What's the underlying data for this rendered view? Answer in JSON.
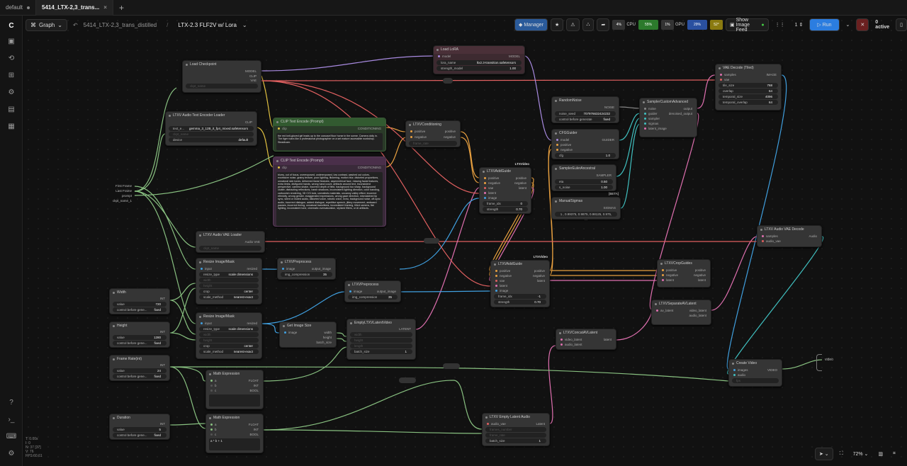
{
  "tabs": [
    {
      "label": "default"
    },
    {
      "label": "5414_LTX-2,3_trans..."
    }
  ],
  "topbar": {
    "graph": "Graph",
    "workflow": "5414_LTX-2,3_trans_distilled",
    "sep": "/",
    "subgraph": "LTX-2.3 FLF2V w/ Lora"
  },
  "toolbar": {
    "manager": "Manager",
    "cpu": "4%",
    "cpu_label": "CPU",
    "ram": "55%",
    "ram_label": "RAM",
    "gpu": "1%",
    "gpu_label": "GPU",
    "vram": "29%",
    "vram_label": "VRAM",
    "temp": "52°",
    "temp_label": "Temp",
    "show_feed": "Show Image Feed",
    "queue": "1",
    "run": "Run",
    "active": "0 active"
  },
  "colors": {
    "blue": "#3a8de0",
    "green": "#5fbf6a",
    "purple": "#a56bd1",
    "pink": "#e070b0",
    "orange": "#e0a040",
    "red": "#e06060",
    "cyan": "#40c0c0"
  },
  "nodes": {
    "lora": {
      "title": "Load LoRA",
      "model": "model",
      "model_out": "MODEL",
      "lora_name": "lora_name",
      "lora_val": "ltx2.3-transition.safetensors",
      "strength": "strength_model",
      "strength_val": "1.00"
    },
    "ckpt": {
      "title": "Load Checkpoint",
      "model": "MODEL",
      "clip": "CLIP",
      "vae": "VAE",
      "ckpt": "ckpt_name"
    },
    "audio_enc": {
      "title": "LTXV Audio Text Encoder Loader",
      "clip": "CLIP",
      "name": "text_e...",
      "name_val": "gemma_3_12B_it_fp4_mixed.safetensors",
      "ckpt": "ckpt_name",
      "device": "device",
      "device_val": "default"
    },
    "pos": {
      "title": "CLIP Text Encode (Prompt)",
      "clip": "clip",
      "out": "CONDITIONING",
      "text": "the red knit-gloved girl leads up to the carousel floor horse in the scene. Camera dolly in. The tiger roars like a professional photographer on a set mature accessible workshop. Steadicam."
    },
    "neg": {
      "title": "CLIP Text Encode (Prompt)",
      "clip": "clip",
      "out": "CONDITIONING",
      "text": "blurry, out of focus, overexposed, underexposed, low contrast, washed out colors, excessive noise, grainy texture, poor lighting, flickering, motion blur, distorted proportions, unnatural skin tones, deformed facial features, asymmetrical face, missing facial features, extra limbs, disfigured hands, wrong hand count, artifacts around text, inconsistent perspective, camera shake, incorrect depth of field, background too sharp, background clutter, distracting reflections, harsh shadows, inconsistent lighting direction, color banding, cartoonish rendering, 3D CGI look, unrealistic materials, uncanny valley effect, incorrect ethnicity, wrong gender, exaggerated expressions, wrong gaze direction, mismatched lip sync, silent or muted audio, distorted voice, robotic voice, echo, background noise, off-sync audio, incorrect dialogue, added dialogue, repetitive speech, jittery movement, awkward pauses, incorrect timing, unnatural transitions, inconsistent framing, tilted camera, flat lighting, inconsistent tone, cinematic oversaturation, stylized filters, or AI artifacts."
    },
    "cond": {
      "title": "LTXVConditioning",
      "pos": "positive",
      "neg": "negative",
      "pos_out": "positive",
      "neg_out": "negative",
      "fr": "frame_rate"
    },
    "add1": {
      "title": "LTXVAddGuide",
      "badge": "LTXVideo",
      "pos": "positive",
      "neg": "negative",
      "vae": "vae",
      "latent": "latent",
      "image": "image",
      "pos_o": "positive",
      "neg_o": "negative",
      "lat_o": "latent",
      "fi": "frame_idx",
      "fi_v": "0",
      "st": "strength",
      "st_v": "0.70"
    },
    "add2": {
      "title": "LTXVAddGuide",
      "badge": "LTXVideo",
      "pos": "positive",
      "neg": "negative",
      "vae": "vae",
      "latent": "latent",
      "image": "image",
      "pos_o": "positive",
      "neg_o": "negative",
      "lat_o": "latent",
      "fi": "frame_idx",
      "fi_v": "-1",
      "st": "strength",
      "st_v": "0.70"
    },
    "noise": {
      "title": "RandomNoise",
      "out": "NOISE",
      "seed": "noise_seed",
      "seed_v": "707976632424232",
      "ctrl": "control before generate",
      "ctrl_v": "fixed"
    },
    "cfg": {
      "title": "CFGGuider",
      "model": "model",
      "pos": "positive",
      "neg": "negative",
      "out": "GUIDER",
      "cfg": "cfg",
      "cfg_v": "1.0"
    },
    "sampsel": {
      "title": "SamplerEulerAncestral",
      "out": "SAMPLER",
      "eta": "eta",
      "eta_v": "0.50",
      "s": "s_noise",
      "s_v": "1.00"
    },
    "sigmas": {
      "title": "ManualSigmas",
      "badge": "[BETA]",
      "out": "SIGMAS",
      "v": "1., 0.99375, 0.9875, 0.98125, 0.975, ..."
    },
    "sca": {
      "title": "SamplerCustomAdvanced",
      "noise": "noise",
      "guider": "guider",
      "sampler": "sampler",
      "sigmas": "sigmas",
      "lat": "latent_image",
      "out": "output",
      "den": "denoised_output"
    },
    "vaedec": {
      "title": "VAE Decode (Tiled)",
      "samples": "samples",
      "vae": "vae",
      "out": "IMAGE",
      "t1": "tile_size",
      "t1v": "768",
      "t2": "overlap",
      "t2v": "64",
      "t3": "temporal_size",
      "t3v": "4096",
      "t4": "temporal_overlap",
      "t4v": "64"
    },
    "avae": {
      "title": "LTXV Audio VAE Loader",
      "out": "Audio VAE",
      "ck": "ckpt_name"
    },
    "adec": {
      "title": "LTXV Audio VAE Decode",
      "samples": "samples",
      "vae": "audio_vae",
      "out": "Audio"
    },
    "rs1": {
      "title": "Resize Image/Mask",
      "input": "input",
      "out": "resized",
      "rt": "resize_type",
      "rtv": "scale dimensions",
      "w": "width",
      "h": "height",
      "c": "crop",
      "cv": "center",
      "sm": "scale_method",
      "smv": "nearest-exact"
    },
    "rs2": {
      "title": "Resize Image/Mask",
      "input": "input",
      "out": "resized",
      "rt": "resize_type",
      "rtv": "scale dimensions",
      "w": "width",
      "h": "height",
      "c": "crop",
      "cv": "center",
      "sm": "scale_method",
      "smv": "nearest-exact"
    },
    "pre1": {
      "title": "LTXVPreprocess",
      "img": "image",
      "out": "output_image",
      "c": "img_compression",
      "cv": "35"
    },
    "pre2": {
      "title": "LTXVPreprocess",
      "img": "image",
      "out": "output_image",
      "c": "img_compression",
      "cv": "35"
    },
    "crop": {
      "title": "LTXVCropGuides",
      "pos": "positive",
      "neg": "negative",
      "lat": "latent",
      "pos_o": "positive",
      "neg_o": "negative",
      "lat_o": "latent"
    },
    "sep": {
      "title": "LTXVSeparateAVLatent",
      "in": "av_latent",
      "vo": "video_latent",
      "ao": "audio_latent"
    },
    "concat": {
      "title": "LTXVConcatAVLatent",
      "v": "video_latent",
      "a": "audio_latent",
      "out": "latent"
    },
    "size": {
      "title": "Get Image Size",
      "img": "image",
      "w": "width",
      "h": "height",
      "b": "batch_size"
    },
    "empty": {
      "title": "EmptyLTXVLatentVideo",
      "out": "LATENT",
      "w": "width",
      "h": "height",
      "l": "length",
      "b": "batch_size",
      "bv": "1"
    },
    "width": {
      "title": "Width",
      "out": "INT",
      "v": "value",
      "vv": "720",
      "c": "control before gene...",
      "cv": "fixed"
    },
    "height": {
      "title": "Height",
      "out": "INT",
      "v": "value",
      "vv": "1280",
      "c": "control before gene...",
      "cv": "fixed"
    },
    "fr": {
      "title": "Frame Rate(int)",
      "out": "INT",
      "v": "value",
      "vv": "24",
      "c": "control before gene...",
      "cv": "fixed"
    },
    "dur": {
      "title": "Duration",
      "out": "INT",
      "v": "value",
      "vv": "5",
      "c": "control before gene...",
      "cv": "fixed"
    },
    "m1": {
      "title": "Math Expression",
      "a": "a",
      "b": "b",
      "c": "c",
      "f": "FLOAT",
      "i": "INT",
      "bo": "BOOL"
    },
    "m2": {
      "title": "Math Expression",
      "a": "a",
      "b": "b",
      "c": "c",
      "f": "FLOAT",
      "i": "INT",
      "bo": "BOOL",
      "expr": "a * b + 1"
    },
    "eaud": {
      "title": "LTXV Empty Latent Audio",
      "in": "audio_vae",
      "out": "Latent",
      "fn": "frames_number",
      "fr": "frame_rate",
      "bs": "batch_size",
      "bv": "1"
    },
    "cv": {
      "title": "Create Video",
      "img": "images",
      "au": "audio",
      "fps": "fps",
      "out": "VIDEO"
    },
    "inputs": {
      "a": "First Frame",
      "b": "Last Frame",
      "c": "prompt",
      "d": "ckpt_name_1"
    },
    "video_out": "video"
  },
  "canvas_stats": {
    "l1": "T: 0.00s",
    "l2": "I: 0",
    "l3": "N: 37 [37]",
    "l4": "V: 76",
    "l5": "FPS:60.61"
  },
  "bottom": {
    "zoom": "72%"
  }
}
